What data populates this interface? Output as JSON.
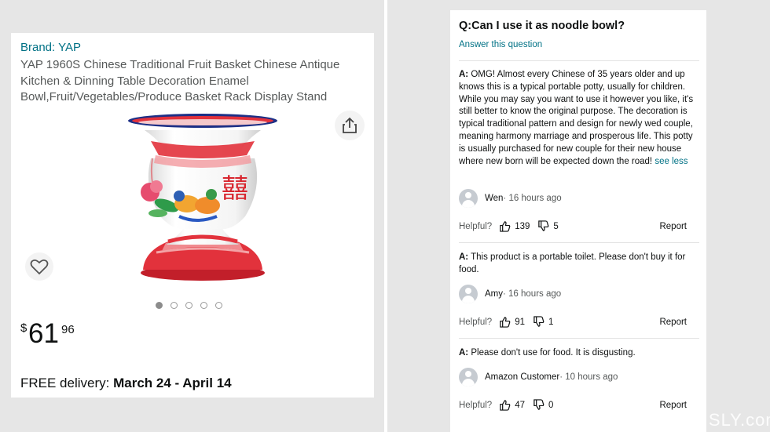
{
  "product": {
    "brand": "Brand: YAP",
    "title": "YAP 1960S Chinese Traditional Fruit Basket Chinese Antique Kitchen & Dinning Table Decoration Enamel Bowl,Fruit/Vegetables/Produce Basket Rack Display Stand",
    "price": {
      "symbol": "$",
      "whole": "61",
      "fraction": "96"
    },
    "delivery_prefix": "FREE delivery: ",
    "delivery_dates": "March 24 - April 14",
    "carousel": {
      "count": 5,
      "active": 1
    },
    "image_glyph": "囍"
  },
  "qa": {
    "question": "Q:Can I use it as noodle bowl?",
    "answer_link": "Answer this question",
    "answer_prefix": "A:",
    "helpful_label": "Helpful?",
    "report_label": "Report",
    "answers": [
      {
        "text": "OMG! Almost every Chinese of 35 years older and up knows this is a typical portable potty, usually for children. While you may say you want to use it however you like, it's still better to know the original purpose. The decoration is typical traditional pattern and design for newly wed couple, meaning harmony marriage and prosperous life. This potty is usually purchased for new couple for their new house where new born will be expected down the road!",
        "see_less": "see less",
        "author": "Wen",
        "time": " · 16 hours ago",
        "up": "139",
        "down": "5"
      },
      {
        "text": "This product is a portable toilet. Please don't buy it for food.",
        "author": "Amy",
        "time": " · 16 hours ago",
        "up": "91",
        "down": "1"
      },
      {
        "text": "Please don't use for food. It is disgusting.",
        "author": "Amazon Customer",
        "time": " · 10 hours ago",
        "up": "47",
        "down": "0"
      }
    ]
  },
  "watermark": "UTYPIMPISLY.com",
  "colors": {
    "link": "#007185",
    "vase_red": "#e2323c",
    "rim_blue": "#1c2f86"
  }
}
